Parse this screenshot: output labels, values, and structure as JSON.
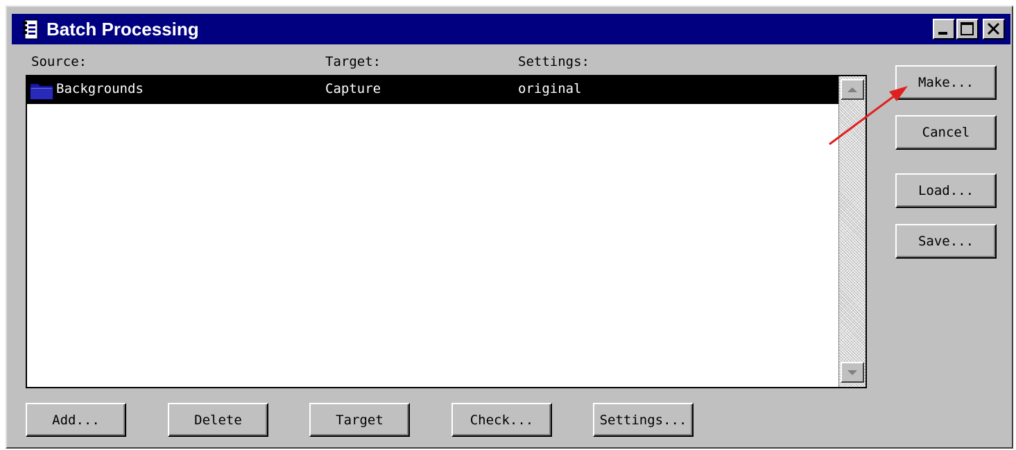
{
  "window": {
    "title": "Batch Processing",
    "title_icon": "application-icon",
    "controls": [
      "minimize-icon",
      "maximize-icon",
      "close-icon"
    ]
  },
  "columns": {
    "source": "Source:",
    "target": "Target:",
    "settings": "Settings:"
  },
  "rows": [
    {
      "icon": "folder-icon",
      "source": "Backgrounds",
      "target": "Capture",
      "settings": "original",
      "selected": true
    }
  ],
  "side_buttons": {
    "make": "Make...",
    "cancel": "Cancel",
    "load": "Load...",
    "save": "Save..."
  },
  "bottom_buttons": {
    "add": "Add...",
    "delete": "Delete",
    "target": "Target",
    "check": "Check...",
    "settings": "Settings..."
  },
  "colors": {
    "titlebar": "#000080",
    "face": "#c0c0c0",
    "selection": "#000000",
    "annotation_arrow": "#e02020"
  },
  "annotation": {
    "type": "arrow",
    "points_to": "make-button"
  }
}
